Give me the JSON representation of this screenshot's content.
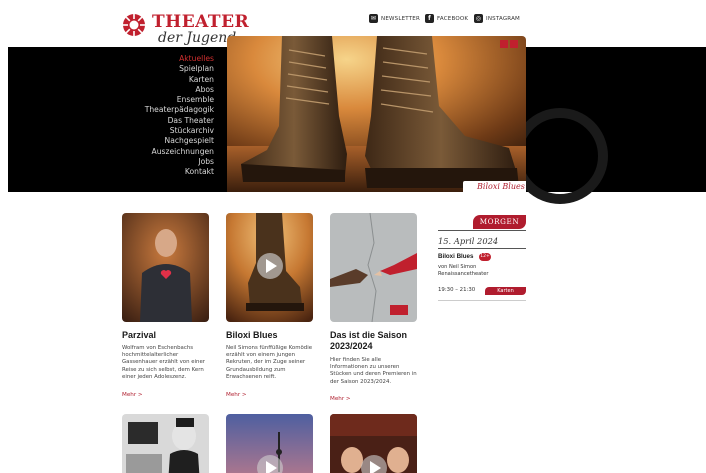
{
  "brand": {
    "name_line1": "THEATER",
    "name_line2": "der Jugend",
    "accent": "#c0202e"
  },
  "social": [
    {
      "label": "NEWSLETTER",
      "icon": "mail-icon"
    },
    {
      "label": "FACEBOOK",
      "icon": "facebook-icon"
    },
    {
      "label": "INSTAGRAM",
      "icon": "instagram-icon"
    }
  ],
  "nav": [
    {
      "label": "Aktuelles",
      "active": true
    },
    {
      "label": "Spielplan"
    },
    {
      "label": "Karten"
    },
    {
      "label": "Abos"
    },
    {
      "label": "Ensemble"
    },
    {
      "label": "Theaterpädagogik"
    },
    {
      "label": "Das Theater"
    },
    {
      "label": "Stückarchiv"
    },
    {
      "label": "Nachgespielt"
    },
    {
      "label": "Auszeichnungen"
    },
    {
      "label": "Jobs"
    },
    {
      "label": "Kontakt"
    }
  ],
  "hero": {
    "caption": "Biloxi Blues"
  },
  "cards": [
    {
      "title": "Parzival",
      "text": [
        "Wolfram von Eschenbachs",
        "hochmittelalterlicher",
        "Gassenhauer erzählt von einer",
        "Reise zu sich selbst, dem Kern",
        "einer jeden Adoleszenz."
      ],
      "more": "Mehr >"
    },
    {
      "title": "Biloxi Blues",
      "text": [
        "Neil Simons fünffüßige Komödie",
        "erzählt von einem jungen",
        "Rekruten, der im Zuge seiner",
        "Grundausbildung zum",
        "Erwachsenen reift."
      ],
      "more": "Mehr >"
    },
    {
      "title_line1": "Das ist die Saison",
      "title_line2": "2023/2024",
      "text": [
        "Hier finden Sie alle",
        "Informationen zu unseren",
        "Stücken und deren Premieren in",
        "der Saison 2023/2024."
      ],
      "more": "Mehr >"
    }
  ],
  "sidebar": {
    "badge": "MORGEN",
    "date": "15. April 2024",
    "title": "Biloxi Blues",
    "age_badge": "12+",
    "author": "von Neil Simon",
    "venue": "Renaissancetheater",
    "time": "19:30 – 21:30",
    "ticket_button": "Karten"
  }
}
